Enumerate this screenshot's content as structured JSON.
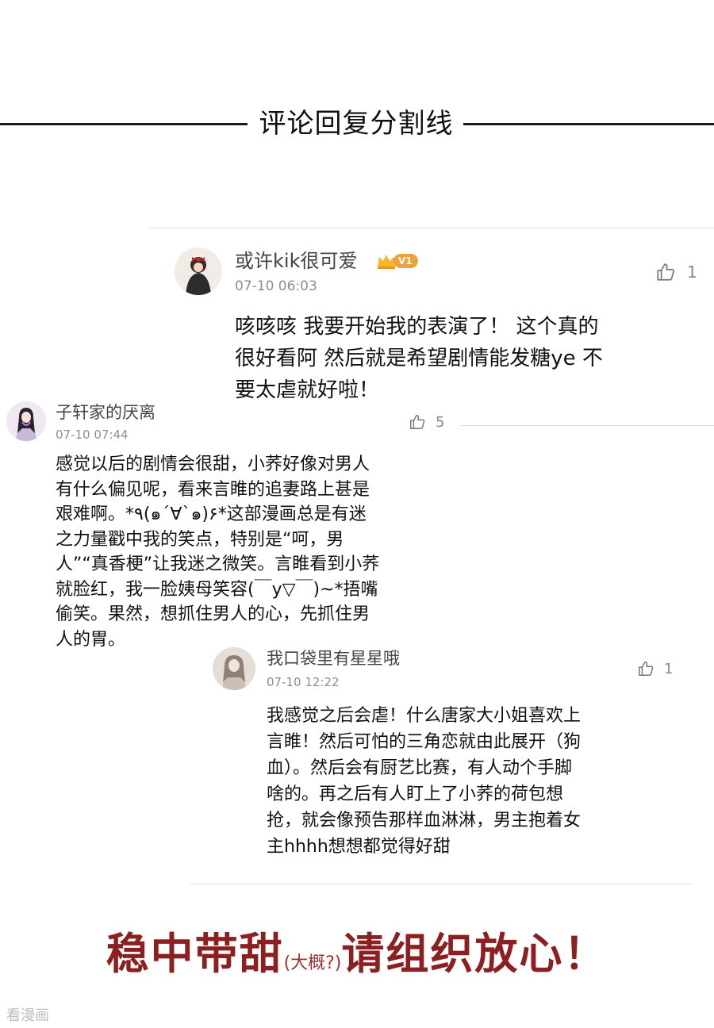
{
  "divider": {
    "title": "评论回复分割线"
  },
  "comments": [
    {
      "user": "或许kik很可爱",
      "vip_badge": "V1",
      "time": "07-10 06:03",
      "likes": "1",
      "text_lines": [
        "咳咳咳 我要开始我的表演了！ 这个真的",
        "很好看阿 然后就是希望剧情能发糖ye 不",
        "要太虐就好啦！"
      ]
    },
    {
      "user": "子轩家的厌离",
      "time": "07-10 07:44",
      "likes": "5",
      "text_lines": [
        "感觉以后的剧情会很甜，小荞好像对男人",
        "有什么偏见呢，看来言睢的追妻路上甚是",
        "艰难啊。*٩(๑´∀`๑)۶*这部漫画总是有迷",
        "之力量戳中我的笑点，特别是“呵，男",
        "人”“真香梗”让我迷之微笑。言睢看到小荞",
        "就脸红，我一脸姨母笑容(￣y▽￣)~*捂嘴",
        "偷笑。果然，想抓住男人的心，先抓住男",
        "人的胃。"
      ]
    },
    {
      "user": "我口袋里有星星哦",
      "time": "07-10 12:22",
      "likes": "1",
      "text_lines": [
        "我感觉之后会虐！什么唐家大小姐喜欢上",
        "言睢！然后可怕的三角恋就由此展开（狗",
        "血）。然后会有厨艺比赛，有人动个手脚",
        "啥的。再之后有人盯上了小荞的荷包想",
        "抢，就会像预告那样血淋淋，男主抱着女",
        "主hhhh想想都觉得好甜"
      ]
    }
  ],
  "slogan": {
    "main1": "稳中带甜",
    "aside": "(大概?)",
    "main2": "请组织放心！"
  },
  "watermark": "看漫画",
  "colors": {
    "slogan": "#8c2020",
    "vip": "#f0a23a"
  }
}
